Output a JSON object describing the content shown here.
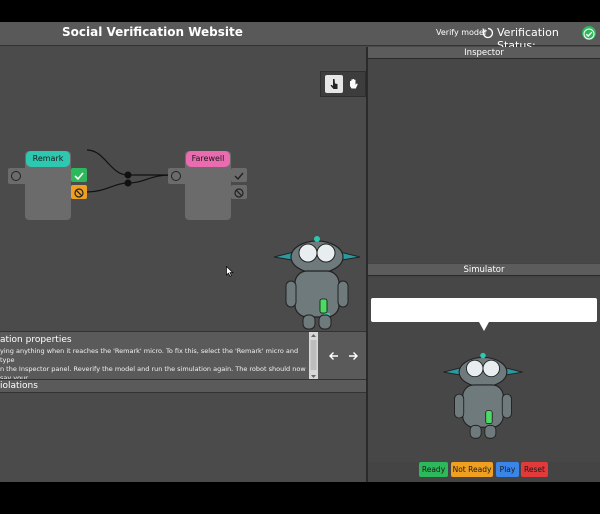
{
  "header": {
    "title": "Social Verification Website",
    "verify_model_label": "Verify model",
    "verification_status_label": "Verification Status:"
  },
  "canvas": {
    "nodes": [
      {
        "label": "Remark",
        "color": "#2ec8b0"
      },
      {
        "label": "Farewell",
        "color": "#e96bb0"
      }
    ]
  },
  "properties": {
    "title": "ation properties",
    "text": "ying anything when it reaches the 'Remark' micro. To fix this, select the 'Remark' micro and type\nn the Inspector panel. Reverify the model and run the simulation again. The robot should now say your\nRemark' micro."
  },
  "violations": {
    "title": "iolations"
  },
  "inspector": {
    "title": "Inspector"
  },
  "simulator": {
    "title": "Simulator",
    "buttons": {
      "ready": "Ready",
      "not_ready": "Not Ready",
      "play": "Play",
      "reset": "Reset"
    }
  },
  "colors": {
    "ready": "#2eb85c",
    "not_ready": "#f0a020",
    "play": "#3a86e8",
    "reset": "#e03a3a"
  }
}
